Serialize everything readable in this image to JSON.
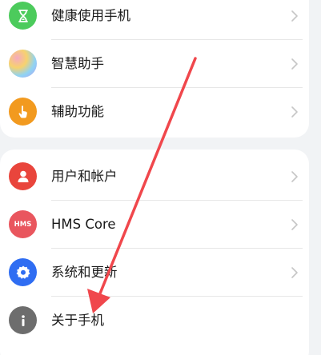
{
  "colors": {
    "hourglass_icon_bg": "#4ccb5c",
    "assistant_icon_gradient": [
      "#f5a9c0",
      "#f7d26e",
      "#8fd3f4",
      "#b79cf2"
    ],
    "accessibility_icon_bg": "#f29a1f",
    "user_icon_bg": "#e9453c",
    "hms_icon_bg": "#e9565e",
    "system_icon_bg": "#2f6df2",
    "about_icon_bg": "#6d6d6d",
    "annotation_arrow": "#f0474c"
  },
  "settings": {
    "group1": [
      {
        "label": "健康使用手机",
        "icon": "hourglass-icon"
      },
      {
        "label": "智慧助手",
        "icon": "assistant-orb-icon"
      },
      {
        "label": "辅助功能",
        "icon": "hand-pointer-icon"
      }
    ],
    "group2": [
      {
        "label": "用户和帐户",
        "icon": "user-icon"
      },
      {
        "label": "HMS Core",
        "icon": "hms-icon",
        "icon_text": "HMS"
      },
      {
        "label": "系统和更新",
        "icon": "gear-icon"
      },
      {
        "label": "关于手机",
        "icon": "info-icon"
      }
    ]
  }
}
